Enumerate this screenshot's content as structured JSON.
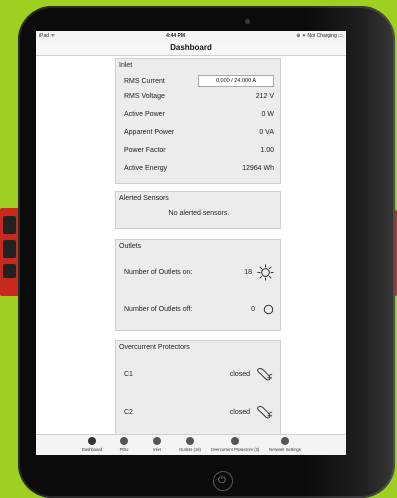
{
  "status_bar": {
    "carrier": "iPad ᯤ",
    "time": "4:44 PM",
    "right": "⊕ ✶ Not Charging ▭"
  },
  "nav": {
    "title": "Dashboard"
  },
  "inlet": {
    "title": "Inlet",
    "rows": [
      {
        "label": "RMS Current",
        "value": "0.000 / 24.000 A"
      },
      {
        "label": "RMS Voltage",
        "value": "212 V"
      },
      {
        "label": "Active Power",
        "value": "0 W"
      },
      {
        "label": "Apparent Power",
        "value": "0 VA"
      },
      {
        "label": "Power Factor",
        "value": "1.00"
      },
      {
        "label": "Active Energy",
        "value": "12964 Wh"
      }
    ]
  },
  "alerted_sensors": {
    "title": "Alerted Sensors",
    "message": "No alerted sensors."
  },
  "outlets": {
    "title": "Outlets",
    "on_label": "Number of Outlets on:",
    "on_value": "18",
    "off_label": "Number of Outlets off:",
    "off_value": "0"
  },
  "overcurrent": {
    "title": "Overcurrent Protectors",
    "items": [
      {
        "name": "C1",
        "state": "closed"
      },
      {
        "name": "C2",
        "state": "closed"
      }
    ]
  },
  "tabs": [
    {
      "label": "Dashboard"
    },
    {
      "label": "PDU"
    },
    {
      "label": "Inlet"
    },
    {
      "label": "Outlets (18)"
    },
    {
      "label": "Overcurrent Protectors (3)"
    },
    {
      "label": "Network Settings"
    }
  ],
  "colors": {
    "background": "#9fd021",
    "tablet": "#0b0b0b",
    "panel": "#ececec"
  },
  "icons": {
    "outlets_on": "sun-icon",
    "outlets_off": "circle-icon",
    "breaker": "breaker-icon",
    "home": "power-icon"
  }
}
